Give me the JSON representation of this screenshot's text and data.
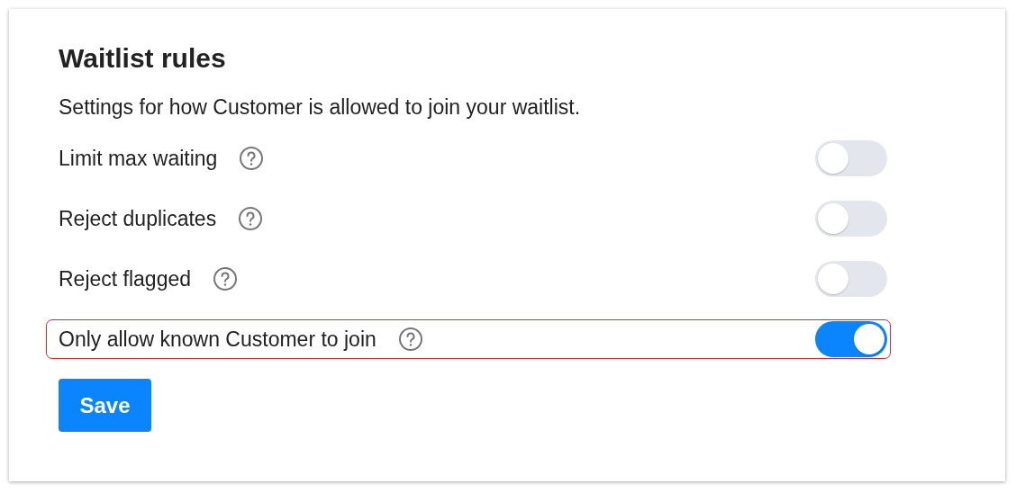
{
  "title": "Waitlist rules",
  "description": "Settings for how Customer is allowed to join your waitlist.",
  "rules": [
    {
      "label": "Limit max waiting",
      "on": false,
      "highlighted": false
    },
    {
      "label": "Reject duplicates",
      "on": false,
      "highlighted": false
    },
    {
      "label": "Reject flagged",
      "on": false,
      "highlighted": false
    },
    {
      "label": "Only allow known Customer to join",
      "on": true,
      "highlighted": true
    }
  ],
  "save_button": "Save"
}
